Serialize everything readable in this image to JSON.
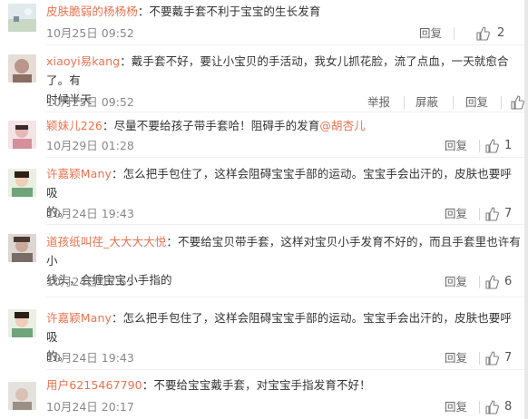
{
  "comments": [
    {
      "user": "皮肤脆弱的杨杨杨",
      "text": "不要戴手套不利于宝宝的生长发育",
      "time": "10月25日 09:52",
      "reply": "回复",
      "likes": "2"
    },
    {
      "user": "xiaoyi易kang",
      "text_line1": "戴手套不好，要让小宝贝的手活动，我女儿抓花脸，流了点血，一天就愈合了。有",
      "text_line2": "时候半天",
      "time": "10月25日 09:52",
      "report": "举报",
      "hide": "屏蔽",
      "reply": "回复"
    },
    {
      "user": "颖妹儿226",
      "text": "尽量不要给孩子带手套哈！阻碍手的发育",
      "mention": "@胡杏儿",
      "time": "10月29日 01:28",
      "reply": "回复",
      "likes": "1"
    },
    {
      "user": "许嘉颖Many",
      "text_line1": "怎么把手包住了，这样会阻碍宝宝手部的运动。宝宝手会出汗的，皮肤也要呼吸",
      "text_line2": "的。",
      "time": "10月24日 19:43",
      "reply": "回复",
      "likes": "7"
    },
    {
      "user": "道孩纸叫荏_大大大大悦",
      "text_line1": "不要给宝贝带手套，这样对宝贝小手发育不好的，而且手套里也许有小",
      "text_line2": "线头，会缠宝宝小手指的",
      "time": "10月24日 17:53",
      "reply": "回复",
      "likes": "6"
    },
    {
      "user": "许嘉颖Many",
      "text_line1": "怎么把手包住了，这样会阻碍宝宝手部的运动。宝宝手会出汗的，皮肤也要呼吸",
      "text_line2": "的。",
      "time": "10月24日 19:43",
      "reply": "回复",
      "likes": "7"
    },
    {
      "user": "用户6215467790",
      "text": "不要给宝宝戴手套，对宝宝手指发育不好！",
      "time": "10月24日 20:17",
      "reply": "回复",
      "likes": "8"
    }
  ],
  "colors": {
    "username": "#eb7350",
    "text": "#333333",
    "meta": "#888888"
  },
  "icons": {
    "like": "thumbs-up-icon"
  }
}
